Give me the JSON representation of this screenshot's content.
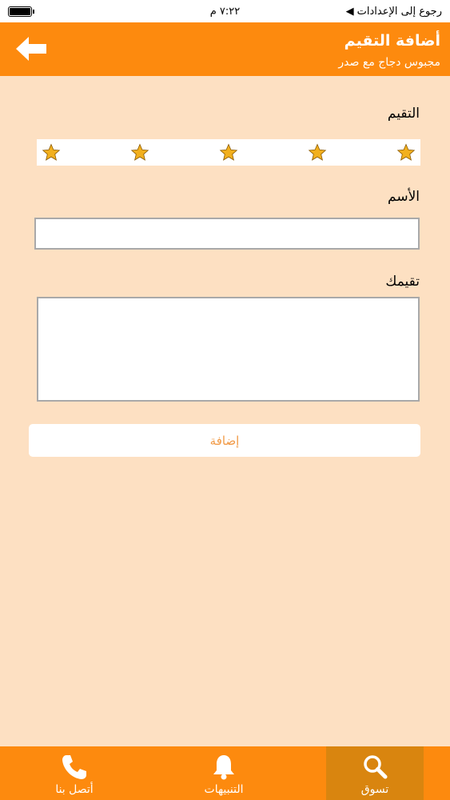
{
  "status_bar": {
    "back_label": "رجوع إلى الإعدادات",
    "time": "٧:٢٢ م"
  },
  "header": {
    "title": "أضافة التقيم",
    "subtitle": "مجبوس دجاج مع صدر"
  },
  "form": {
    "rating_label": "التقيم",
    "rating_stars": 5,
    "name_label": "الأسم",
    "name_value": "",
    "review_label": "تقيمك",
    "review_value": "",
    "submit_label": "إضافة"
  },
  "colors": {
    "accent": "#fd8a0e",
    "background": "#fde0c2",
    "star": "#f2b01e",
    "button_text": "#f19a46"
  },
  "tabbar": {
    "tabs": [
      {
        "label": "تسوق",
        "icon": "search-icon",
        "active": true
      },
      {
        "label": "التنبيهات",
        "icon": "bell-icon",
        "active": false
      },
      {
        "label": "أتصل بنا",
        "icon": "phone-icon",
        "active": false
      }
    ]
  }
}
